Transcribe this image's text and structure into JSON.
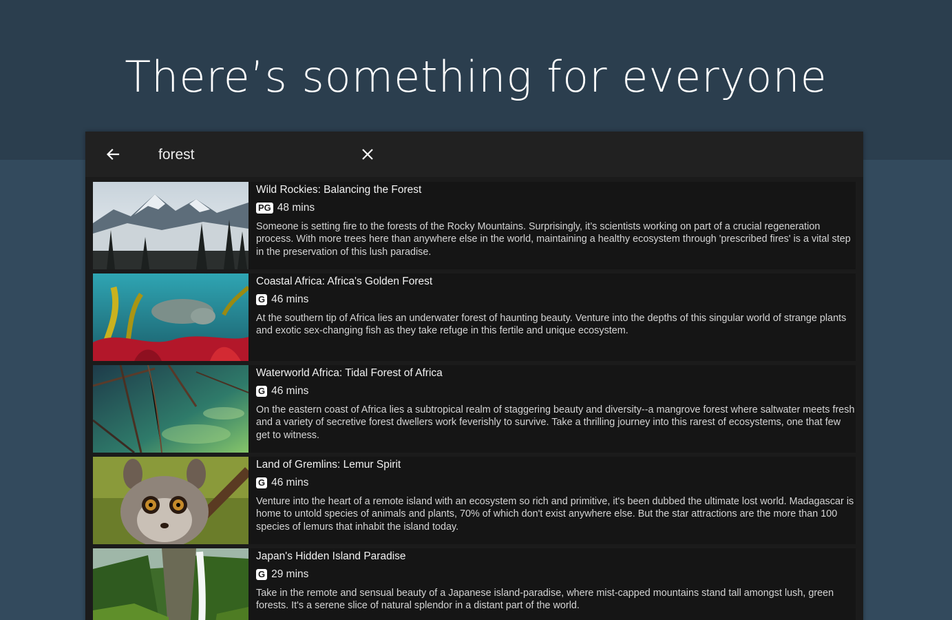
{
  "headline": "There’s something for everyone",
  "search": {
    "query": "forest"
  },
  "results": [
    {
      "title": "Wild Rockies: Balancing the Forest",
      "rating": "PG",
      "duration": "48 mins",
      "description": "Someone is setting fire to the forests of the Rocky Mountains. Surprisingly, it’s scientists working on part of a crucial regeneration process. With more trees here than anywhere else in the world, maintaining a healthy ecosystem through 'prescribed fires' is a vital step in the preservation of this lush paradise."
    },
    {
      "title": "Coastal Africa: Africa's Golden Forest",
      "rating": "G",
      "duration": "46 mins",
      "description": "At the southern tip of Africa lies an underwater forest of haunting beauty. Venture into the depths of this singular world of strange plants and exotic sex-changing fish as they take refuge in this fertile and unique ecosystem."
    },
    {
      "title": "Waterworld Africa: Tidal Forest of Africa",
      "rating": "G",
      "duration": "46 mins",
      "description": "On the eastern coast of Africa lies a subtropical realm of staggering beauty and diversity--a mangrove forest where saltwater meets fresh and a variety of secretive forest dwellers work feverishly to survive. Take a thrilling journey into this rarest of ecosystems, one that few get to witness."
    },
    {
      "title": "Land of Gremlins: Lemur Spirit",
      "rating": "G",
      "duration": "46 mins",
      "description": "Venture into the heart of a remote island with an ecosystem so rich and primitive, it's been dubbed the ultimate lost world. Madagascar is home to untold species of animals and plants, 70% of which don't exist anywhere else. But the star attractions are the more than 100 species of lemurs that inhabit the island today."
    },
    {
      "title": "Japan's Hidden Island Paradise",
      "rating": "G",
      "duration": "29 mins",
      "description": "Take in the remote and sensual beauty of a Japanese island-paradise, where mist-capped mountains stand tall amongst lush, green forests. It's a serene slice of natural splendor in a distant part of the world."
    }
  ],
  "icons": {
    "back": "arrow-left-icon",
    "clear": "close-icon"
  },
  "colors": {
    "top_band": "#2b3e4e",
    "background": "#334a5d",
    "panel": "#1b1b1b",
    "item": "#151515"
  }
}
